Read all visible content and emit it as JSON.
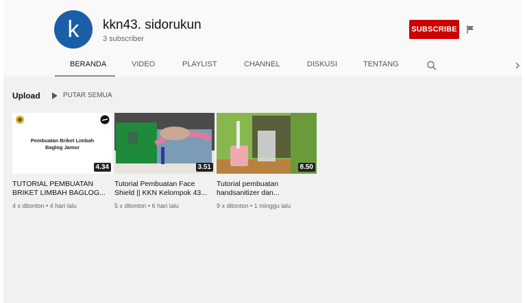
{
  "channel": {
    "avatar_letter": "k",
    "name": "kkn43. sidorukun",
    "subscribers": "3 subscriber",
    "subscribe_label": "SUBSCRIBE"
  },
  "tabs": [
    {
      "label": "BERANDA",
      "active": true
    },
    {
      "label": "VIDEO",
      "active": false
    },
    {
      "label": "PLAYLIST",
      "active": false
    },
    {
      "label": "CHANNEL",
      "active": false
    },
    {
      "label": "DISKUSI",
      "active": false
    },
    {
      "label": "TENTANG",
      "active": false
    }
  ],
  "section": {
    "title": "Upload",
    "play_all": "PUTAR SEMUA"
  },
  "videos": [
    {
      "thumb_text": "Pembuatan Briket Limbah Baglog Jamur",
      "duration": "4.34",
      "title": "TUTORIAL PEMBUATAN BRIKET LIMBAH BAGLOG...",
      "meta": "4 x ditonton • 4 hari lalu"
    },
    {
      "duration": "3.51",
      "title": "Tutorial Pembuatan Face Shield || KKN Kelompok 43...",
      "meta": "5 x ditonton • 6 hari lalu"
    },
    {
      "duration": "8.50",
      "title": "Tutorial pembuatan handsanitizer dan...",
      "meta": "9 x ditonton • 1 minggu lalu"
    }
  ],
  "colors": {
    "subscribe_bg": "#cc0000",
    "avatar_bg": "#1a5fa8"
  }
}
